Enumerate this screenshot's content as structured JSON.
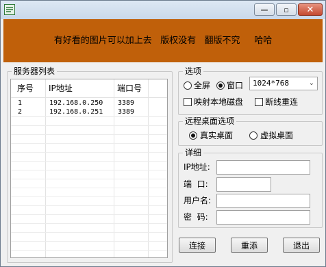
{
  "window": {
    "minimize_glyph": "—",
    "maximize_glyph": "▫",
    "close_glyph": "✕",
    "icons": {
      "app": "app-window-icon",
      "minimize": "minimize-icon",
      "maximize": "maximize-icon",
      "close": "close-icon"
    }
  },
  "banner": {
    "text": "有好看的图片可以加上去   版权没有   翻版不究     哈哈",
    "background": "#c0600a"
  },
  "server_list": {
    "title": "服务器列表",
    "columns": [
      "序号",
      "IP地址",
      "端口号"
    ],
    "rows": [
      {
        "index": "1",
        "ip": "192.168.0.250",
        "port": "3389"
      },
      {
        "index": "2",
        "ip": "192.168.0.251",
        "port": "3389"
      }
    ]
  },
  "options": {
    "title": "选项",
    "fullscreen_label": "全屏",
    "window_label": "窗口",
    "window_selected": true,
    "resolution": "1024*768",
    "map_disk_label": "映射本地磁盘",
    "map_disk_checked": false,
    "reconnect_label": "断线重连",
    "reconnect_checked": false
  },
  "remote_desktop": {
    "title": "远程桌面选项",
    "real_label": "真实桌面",
    "virtual_label": "虚拟桌面",
    "real_selected": true
  },
  "details": {
    "title": "详细",
    "ip_label": "IP地址:",
    "ip_value": "",
    "port_label": "端  口:",
    "port_value": "",
    "user_label": "用户名:",
    "user_value": "",
    "password_label": "密  码:",
    "password_value": ""
  },
  "actions": {
    "connect": "连接",
    "add": "重添",
    "exit": "退出"
  }
}
